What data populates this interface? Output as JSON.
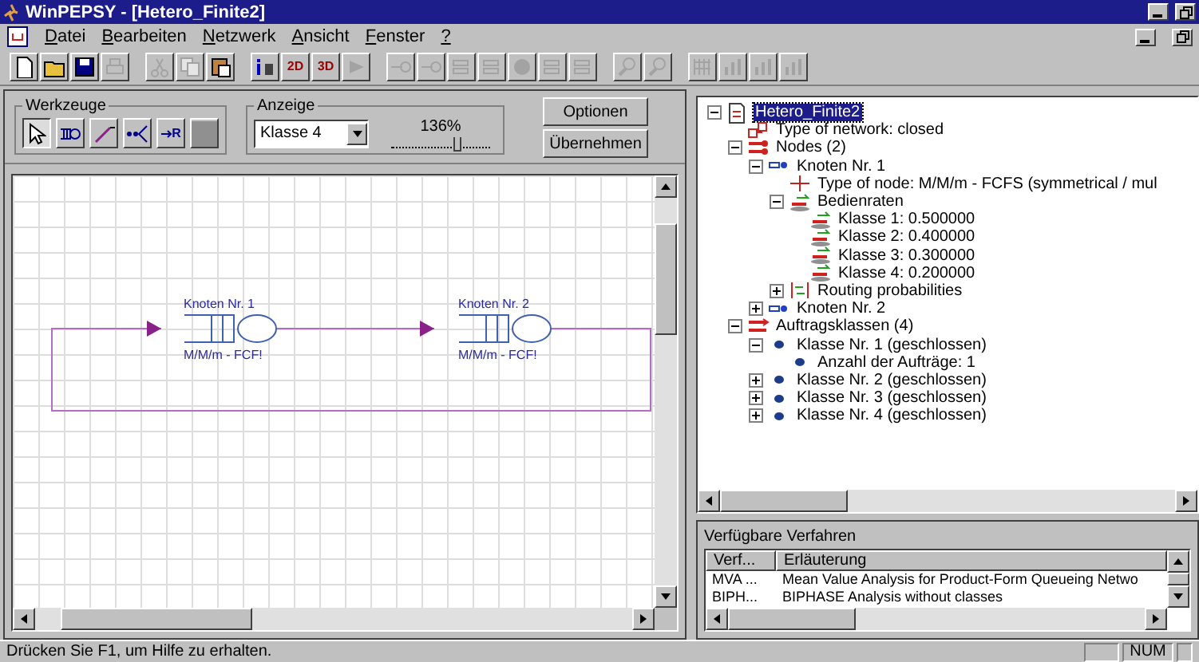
{
  "window": {
    "title": "WinPEPSY - [Hetero_Finite2]"
  },
  "menu": [
    "Datei",
    "Bearbeiten",
    "Netzwerk",
    "Ansicht",
    "Fenster",
    "?"
  ],
  "toolbar": [
    {
      "kind": "new",
      "disabled": false
    },
    {
      "kind": "open",
      "disabled": false
    },
    {
      "kind": "save",
      "disabled": false
    },
    {
      "kind": "print",
      "disabled": true
    },
    {
      "kind": "sep"
    },
    {
      "kind": "cut",
      "disabled": true
    },
    {
      "kind": "copy",
      "disabled": true
    },
    {
      "kind": "paste",
      "disabled": false
    },
    {
      "kind": "sep"
    },
    {
      "kind": "info",
      "disabled": false
    },
    {
      "kind": "text",
      "label": "2D",
      "disabled": false
    },
    {
      "kind": "text",
      "label": "3D",
      "disabled": false
    },
    {
      "kind": "play",
      "disabled": true
    },
    {
      "kind": "sep"
    },
    {
      "kind": "arrow",
      "disabled": true
    },
    {
      "kind": "arrow",
      "disabled": true
    },
    {
      "kind": "bars",
      "disabled": true
    },
    {
      "kind": "bars",
      "disabled": true
    },
    {
      "kind": "circle",
      "disabled": true
    },
    {
      "kind": "bars",
      "disabled": true
    },
    {
      "kind": "bars",
      "disabled": true
    },
    {
      "kind": "sep"
    },
    {
      "kind": "zoom",
      "disabled": true
    },
    {
      "kind": "zoom",
      "disabled": true
    },
    {
      "kind": "sep"
    },
    {
      "kind": "grid",
      "disabled": true
    },
    {
      "kind": "chart",
      "disabled": true
    },
    {
      "kind": "chart",
      "disabled": true
    },
    {
      "kind": "chart",
      "disabled": true
    }
  ],
  "tools": {
    "title": "Werkzeuge",
    "items": [
      {
        "kind": "pointer",
        "selected": true
      },
      {
        "kind": "node"
      },
      {
        "kind": "line"
      },
      {
        "kind": "branch"
      },
      {
        "kind": "route",
        "label": "R"
      },
      {
        "kind": "fill"
      }
    ]
  },
  "display": {
    "title": "Anzeige",
    "select": "Klasse 4",
    "zoom": "136%",
    "level": 0.68
  },
  "buttons": [
    "Optionen",
    "Übernehmen"
  ],
  "canvas": {
    "nodes": [
      {
        "name": "Knoten Nr. 1",
        "type": "M/M/m - FCF!"
      },
      {
        "name": "Knoten Nr. 2",
        "type": "M/M/m - FCF!"
      }
    ]
  },
  "tree": [
    {
      "label": "Hetero_Finite2",
      "kind": "document",
      "selected": true,
      "expanded": true,
      "children": [
        {
          "label": "Type of network: closed",
          "kind": "network"
        },
        {
          "label": "Nodes (2)",
          "kind": "nodes",
          "expanded": true,
          "children": [
            {
              "label": "Knoten Nr. 1",
              "kind": "node",
              "expanded": true,
              "children": [
                {
                  "label": "Type of node: M/M/m - FCFS (symmetrical / mul",
                  "kind": "type"
                },
                {
                  "label": "Bedienraten",
                  "kind": "rates",
                  "expanded": true,
                  "children": [
                    {
                      "label": "Klasse 1: 0.500000",
                      "kind": "rates"
                    },
                    {
                      "label": "Klasse 2: 0.400000",
                      "kind": "rates"
                    },
                    {
                      "label": "Klasse 3: 0.300000",
                      "kind": "rates"
                    },
                    {
                      "label": "Klasse 4: 0.200000",
                      "kind": "rates"
                    }
                  ]
                },
                {
                  "label": "Routing probabilities",
                  "kind": "routing",
                  "expanded": false
                }
              ]
            },
            {
              "label": "Knoten Nr. 2",
              "kind": "node",
              "expanded": false
            }
          ]
        },
        {
          "label": "Auftragsklassen (4)",
          "kind": "classes",
          "expanded": true,
          "children": [
            {
              "label": "Klasse Nr. 1 (geschlossen)",
              "kind": "dot",
              "expanded": true,
              "children": [
                {
                  "label": "Anzahl der Aufträge: 1",
                  "kind": "dot"
                }
              ]
            },
            {
              "label": "Klasse Nr. 2 (geschlossen)",
              "kind": "dot",
              "expanded": false
            },
            {
              "label": "Klasse Nr. 3 (geschlossen)",
              "kind": "dot",
              "expanded": false
            },
            {
              "label": "Klasse Nr. 4 (geschlossen)",
              "kind": "dot",
              "expanded": false
            }
          ]
        }
      ]
    }
  ],
  "methods": {
    "title": "Verfügbare Verfahren",
    "columns": [
      "Verf...",
      "Erläuterung"
    ],
    "rows": [
      [
        "MVA ...",
        "Mean Value Analysis for Product-Form Queueing Netwo"
      ],
      [
        "BIPH...",
        "BIPHASE Analysis without classes"
      ]
    ]
  },
  "status_bar": {
    "text": "Drücken Sie F1, um Hilfe zu erhalten.",
    "indicator": "NUM"
  }
}
